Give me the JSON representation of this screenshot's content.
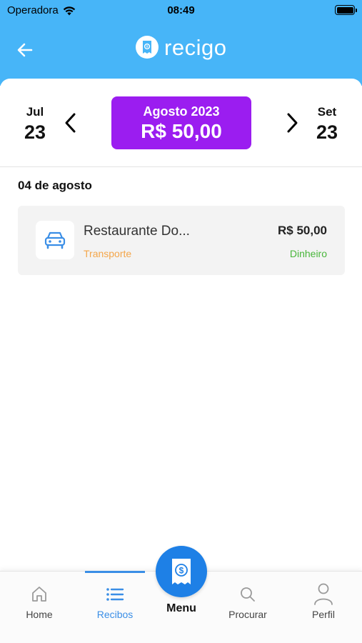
{
  "status_bar": {
    "carrier": "Operadora",
    "time": "08:49"
  },
  "header": {
    "brand_name": "recigo",
    "back_icon": "arrow-left-icon",
    "logo_icon": "receipt-logo-icon"
  },
  "month_nav": {
    "prev": {
      "label": "Jul",
      "year": "23"
    },
    "current": {
      "label": "Agosto 2023",
      "total": "R$ 50,00"
    },
    "next": {
      "label": "Set",
      "year": "23"
    }
  },
  "receipts": {
    "date_heading": "04 de agosto",
    "items": [
      {
        "name": "Restaurante Do...",
        "category": "Transporte",
        "amount": "R$ 50,00",
        "payment": "Dinheiro",
        "icon": "car-icon"
      }
    ]
  },
  "tabbar": {
    "home": "Home",
    "receipts": "Recibos",
    "menu": "Menu",
    "search": "Procurar",
    "profile": "Perfil"
  },
  "colors": {
    "header_blue": "#47b5f8",
    "current_month_purple": "#9b1df0",
    "category_orange": "#f4a64a",
    "payment_green": "#49b63b",
    "active_tab_blue": "#3a8ee6",
    "menu_fab_blue": "#1e80e6"
  }
}
